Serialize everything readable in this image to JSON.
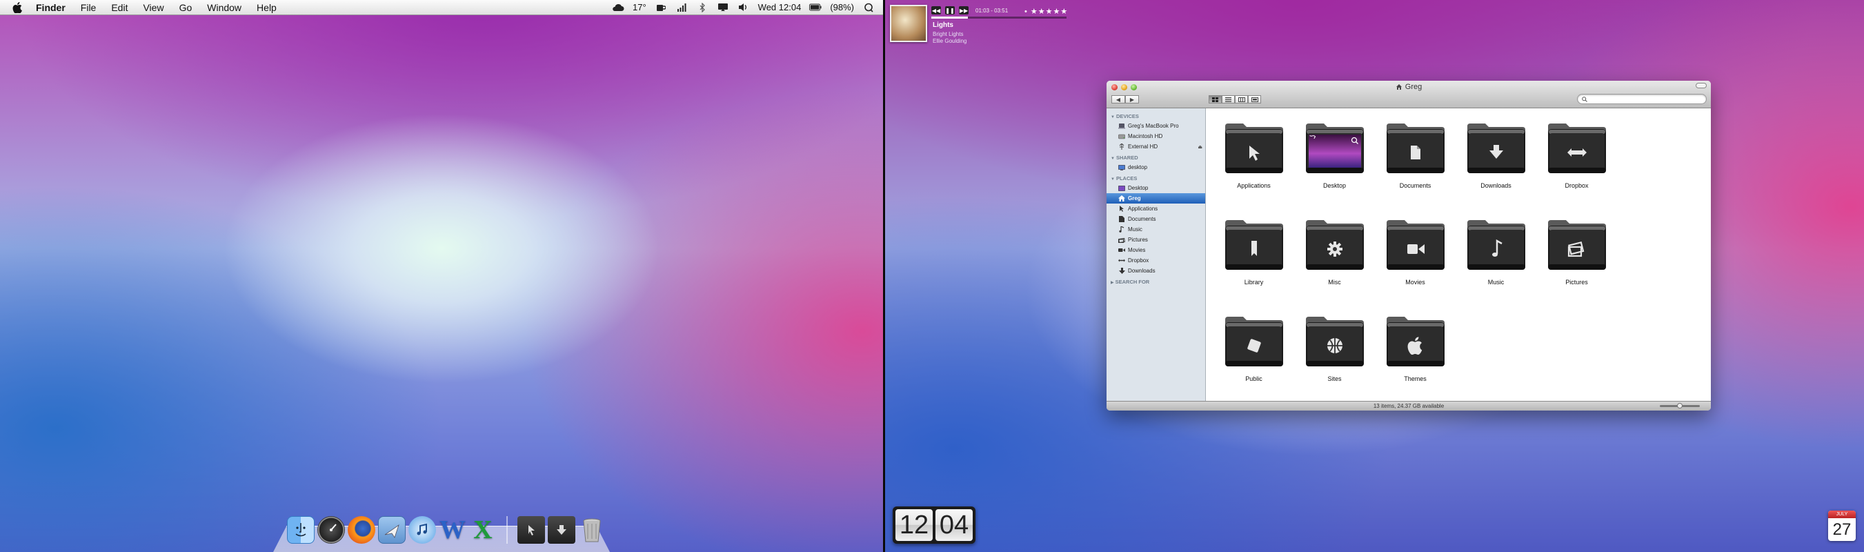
{
  "menubar": {
    "app_name": "Finder",
    "menus": [
      "File",
      "Edit",
      "View",
      "Go",
      "Window",
      "Help"
    ],
    "weather": "17°",
    "clock": "Wed 12:04",
    "battery": "(98%)",
    "icons": [
      "apple-icon",
      "cloud-icon",
      "coffee-cup-icon",
      "signal-icon",
      "bluetooth-icon",
      "display-icon",
      "volume-icon",
      "battery-icon",
      "spotlight-icon"
    ]
  },
  "now_playing": {
    "time": "01:03 - 03:51",
    "title": "Lights",
    "album": "Bright Lights",
    "artist": "Ellie Goulding",
    "stars": "• ★★★★★",
    "progress": 0.27
  },
  "flip_clock": {
    "hours": "12",
    "minutes": "04"
  },
  "calendar": {
    "month": "JULY",
    "day": "27"
  },
  "dock": {
    "items": [
      "finder-icon",
      "dashboard-icon",
      "firefox-icon",
      "mail-icon",
      "itunes-icon",
      "word-icon",
      "excel-icon",
      "applications-stack-icon",
      "downloads-stack-icon",
      "trash-icon"
    ]
  },
  "finder": {
    "title": "Greg",
    "search_placeholder": "",
    "status": "13 items, 24.37 GB available",
    "icon_size_slider": 0.5,
    "sidebar": {
      "devices_header": "DEVICES",
      "devices": [
        {
          "label": "Greg's MacBook Pro",
          "icon": "laptop-icon"
        },
        {
          "label": "Macintosh HD",
          "icon": "hard-drive-icon"
        },
        {
          "label": "External HD",
          "icon": "usb-drive-icon",
          "eject": "⏏"
        }
      ],
      "shared_header": "SHARED",
      "shared": [
        {
          "label": "desktop",
          "icon": "network-computer-icon"
        }
      ],
      "places_header": "PLACES",
      "places": [
        {
          "label": "Desktop",
          "icon": "desktop-icon"
        },
        {
          "label": "Greg",
          "icon": "home-icon",
          "selected": true
        },
        {
          "label": "Applications",
          "icon": "applications-icon"
        },
        {
          "label": "Documents",
          "icon": "documents-icon"
        },
        {
          "label": "Music",
          "icon": "music-icon"
        },
        {
          "label": "Pictures",
          "icon": "pictures-icon"
        },
        {
          "label": "Movies",
          "icon": "movies-icon"
        },
        {
          "label": "Dropbox",
          "icon": "dropbox-icon"
        },
        {
          "label": "Downloads",
          "icon": "downloads-icon"
        }
      ],
      "search_header": "SEARCH FOR"
    },
    "folders": [
      {
        "label": "Applications",
        "icon": "cursor-folder-icon"
      },
      {
        "label": "Desktop",
        "icon": "desktop-folder-icon"
      },
      {
        "label": "Documents",
        "icon": "document-folder-icon"
      },
      {
        "label": "Downloads",
        "icon": "download-folder-icon"
      },
      {
        "label": "Dropbox",
        "icon": "dropbox-folder-icon"
      },
      {
        "label": "Library",
        "icon": "bookmark-folder-icon"
      },
      {
        "label": "Misc",
        "icon": "gear-folder-icon"
      },
      {
        "label": "Movies",
        "icon": "video-folder-icon"
      },
      {
        "label": "Music",
        "icon": "music-note-folder-icon"
      },
      {
        "label": "Pictures",
        "icon": "pictures-folder-icon"
      },
      {
        "label": "Public",
        "icon": "public-folder-icon"
      },
      {
        "label": "Sites",
        "icon": "globe-folder-icon"
      },
      {
        "label": "Themes",
        "icon": "apple-folder-icon"
      }
    ]
  },
  "colors": {
    "selection": "#1f5fb8",
    "sidebar_bg": "#dde4eb",
    "folder_dark": "#2b2b2b"
  }
}
